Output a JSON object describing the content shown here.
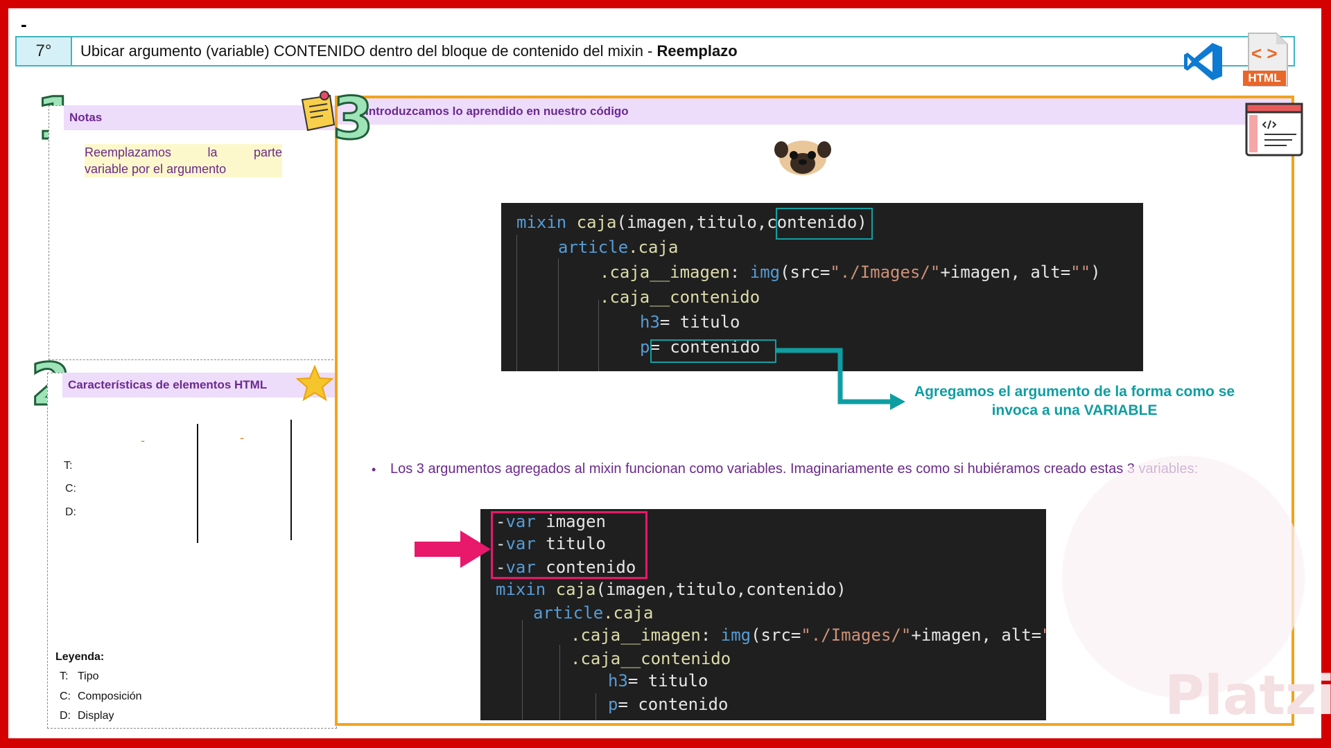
{
  "top_mark": "-",
  "header": {
    "step": "7°",
    "title_plain": "Ubicar argumento (variable) CONTENIDO dentro del bloque de contenido del mixin - ",
    "title_bold": "Reemplazo",
    "html_badge": "HTML",
    "html_badge_glyph": "< >"
  },
  "panel1": {
    "number": "1",
    "title": "Notas",
    "note_line1": [
      "Reemplazamos",
      "la",
      "parte"
    ],
    "note_line2": "variable por el argumento"
  },
  "panel2": {
    "number": "2",
    "title": "Características de elementos HTML",
    "col_dash_1": "-",
    "col_dash_2": "-",
    "rows": [
      "T:",
      "C:",
      "D:"
    ],
    "legend_title": "Leyenda:",
    "legend": [
      {
        "key": "T:",
        "value": "Tipo"
      },
      {
        "key": "C:",
        "value": "Composición"
      },
      {
        "key": "D:",
        "value": "Display"
      }
    ]
  },
  "panel3": {
    "number": "3",
    "title": "Introduzcamos lo aprendido en nuestro código",
    "annotation": "Agregamos el argumento de la forma como se invoca a una VARIABLE",
    "bullet": "Los 3 argumentos agregados al mixin funcionan como variables. Imaginariamente es como si hubiéramos creado estas 3 variables:"
  },
  "code1": {
    "l1_kw": "mixin",
    "l1_fn": "caja",
    "l1_args": "(imagen,titulo,",
    "l1_arg3": "contenido",
    "l1_close": ")",
    "l2_tag": "article",
    "l2_cls": ".caja",
    "l3_cls": ".caja__imagen",
    "l3_colon": ":",
    "l3_tag": "img",
    "l3_open": "(src=",
    "l3_str": "\"./Images/\"",
    "l3_rest": "+imagen, alt=",
    "l3_str2": "\"\"",
    "l3_close": ")",
    "l4_cls": ".caja__contenido",
    "l5_tag": "h3",
    "l5_rest": "= titulo",
    "l6_tag": "p",
    "l6_rest": "= contenido"
  },
  "code2": {
    "v1_dash": "-",
    "v1_kw": "var",
    "v1_name": "imagen",
    "v2_dash": "-",
    "v2_kw": "var",
    "v2_name": "titulo",
    "v3_dash": "-",
    "v3_kw": "var",
    "v3_name": "contenido",
    "l1_kw": "mixin",
    "l1_fn": "caja",
    "l1_args": "(imagen,titulo,contenido)",
    "l2_tag": "article",
    "l2_cls": ".caja",
    "l3_cls": ".caja__imagen",
    "l3_colon": ":",
    "l3_tag": "img",
    "l3_open": "(src=",
    "l3_str": "\"./Images/\"",
    "l3_rest": "+imagen, alt=",
    "l3_str2": "\"\"",
    "l3_close": ")",
    "l4_cls": ".caja__contenido",
    "l5_tag": "h3",
    "l5_rest": "= titulo",
    "l6_tag": "p",
    "l6_rest": "= contenido"
  },
  "colors": {
    "frame": "#d40000",
    "header_border": "#3fb3c2",
    "panel_head": "#eedcfb",
    "accent_orange": "#f2a31c",
    "teal": "#12a0a4",
    "pink": "#e8186b"
  }
}
